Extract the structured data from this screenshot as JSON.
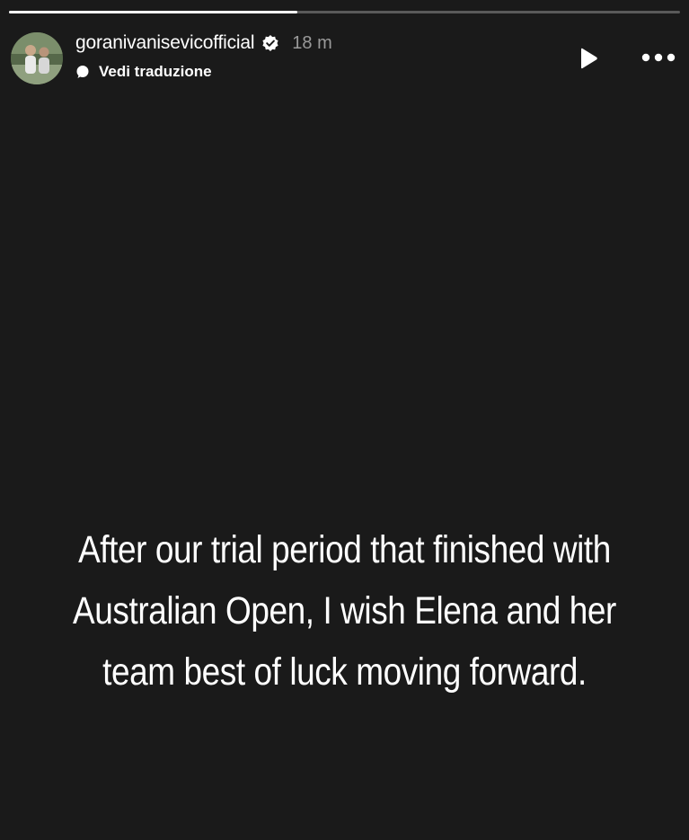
{
  "story": {
    "progress": 0.43,
    "account": {
      "username": "goranivanisevicofficial",
      "verified": true,
      "time_ago": "18 m"
    },
    "translate_label": "Vedi traduzione",
    "controls": {
      "play_icon": "play-icon",
      "more_icon": "more-options-icon"
    },
    "caption": "After our trial period that finished with Australian Open, I wish Elena and her team best of luck moving forward."
  },
  "colors": {
    "background": "#1a1a1a",
    "text": "#ffffff",
    "muted": "#9a9a9a",
    "progress_track": "#5a5a5a"
  }
}
